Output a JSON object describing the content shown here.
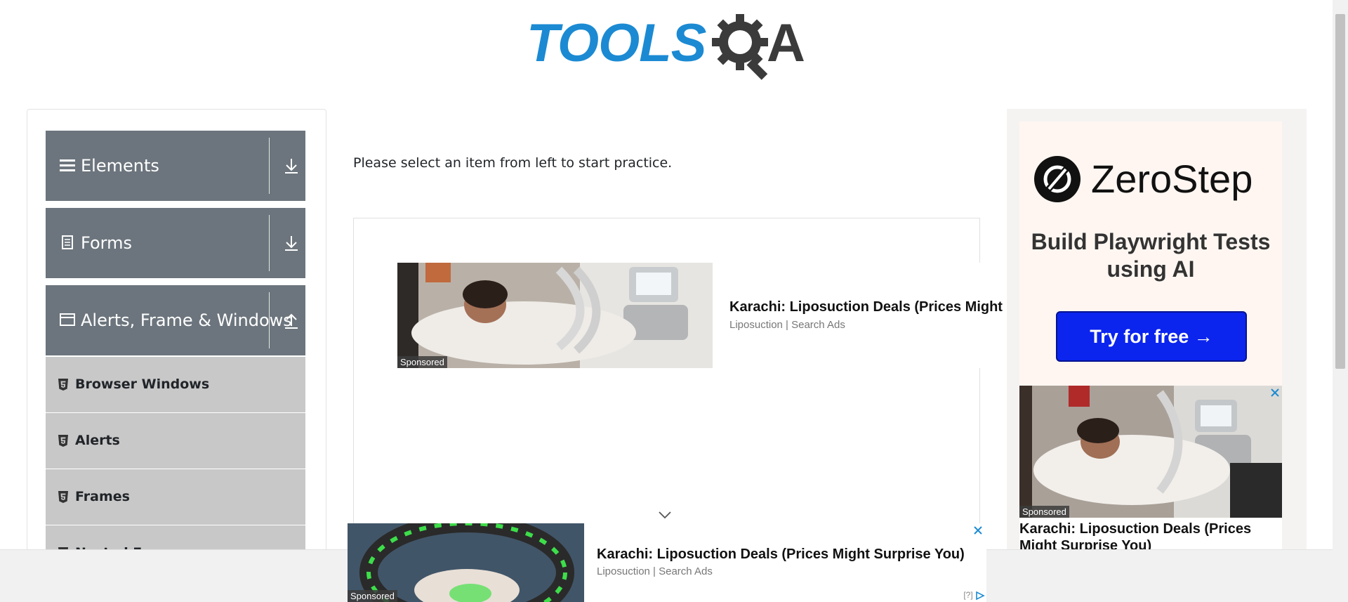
{
  "brand": {
    "logo_text": "TOOLS",
    "logo_suffix": "A",
    "logo_color": "#1b8ad3"
  },
  "sidebar": {
    "groups": [
      {
        "label": "Elements",
        "icon": "hamburger-icon",
        "expanded": false
      },
      {
        "label": "Forms",
        "icon": "document-icon",
        "expanded": false
      },
      {
        "label": "Alerts, Frame & Windows",
        "icon": "window-icon",
        "expanded": true
      }
    ],
    "subitems": [
      {
        "label": "Browser Windows",
        "icon": "html5-icon"
      },
      {
        "label": "Alerts",
        "icon": "html5-icon"
      },
      {
        "label": "Frames",
        "icon": "html5-icon"
      },
      {
        "label": "Nested Frames",
        "icon": "html5-icon"
      }
    ],
    "header_color": "#6c757d",
    "subitem_color": "#c8c8c8"
  },
  "main": {
    "prompt": "Please select an item from left to start practice."
  },
  "ads": {
    "inline": {
      "title": "Karachi: Liposuction Deals (Prices Might Surprise You)",
      "source": "Liposuction | Search Ads",
      "badge": "Sponsored"
    },
    "right": {
      "brand": "ZeroStep",
      "tagline": "Build Playwright Tests using AI",
      "cta": "Try for free →",
      "cta_color": "#0b24ee",
      "card_title": "Karachi: Liposuction Deals (Prices Might Surprise You)",
      "badge": "Sponsored"
    },
    "bottom": {
      "title": "Karachi: Liposuction Deals (Prices Might Surprise You)",
      "source": "Liposuction | Search Ads",
      "badge": "Sponsored",
      "adchoice": "[?]"
    }
  }
}
